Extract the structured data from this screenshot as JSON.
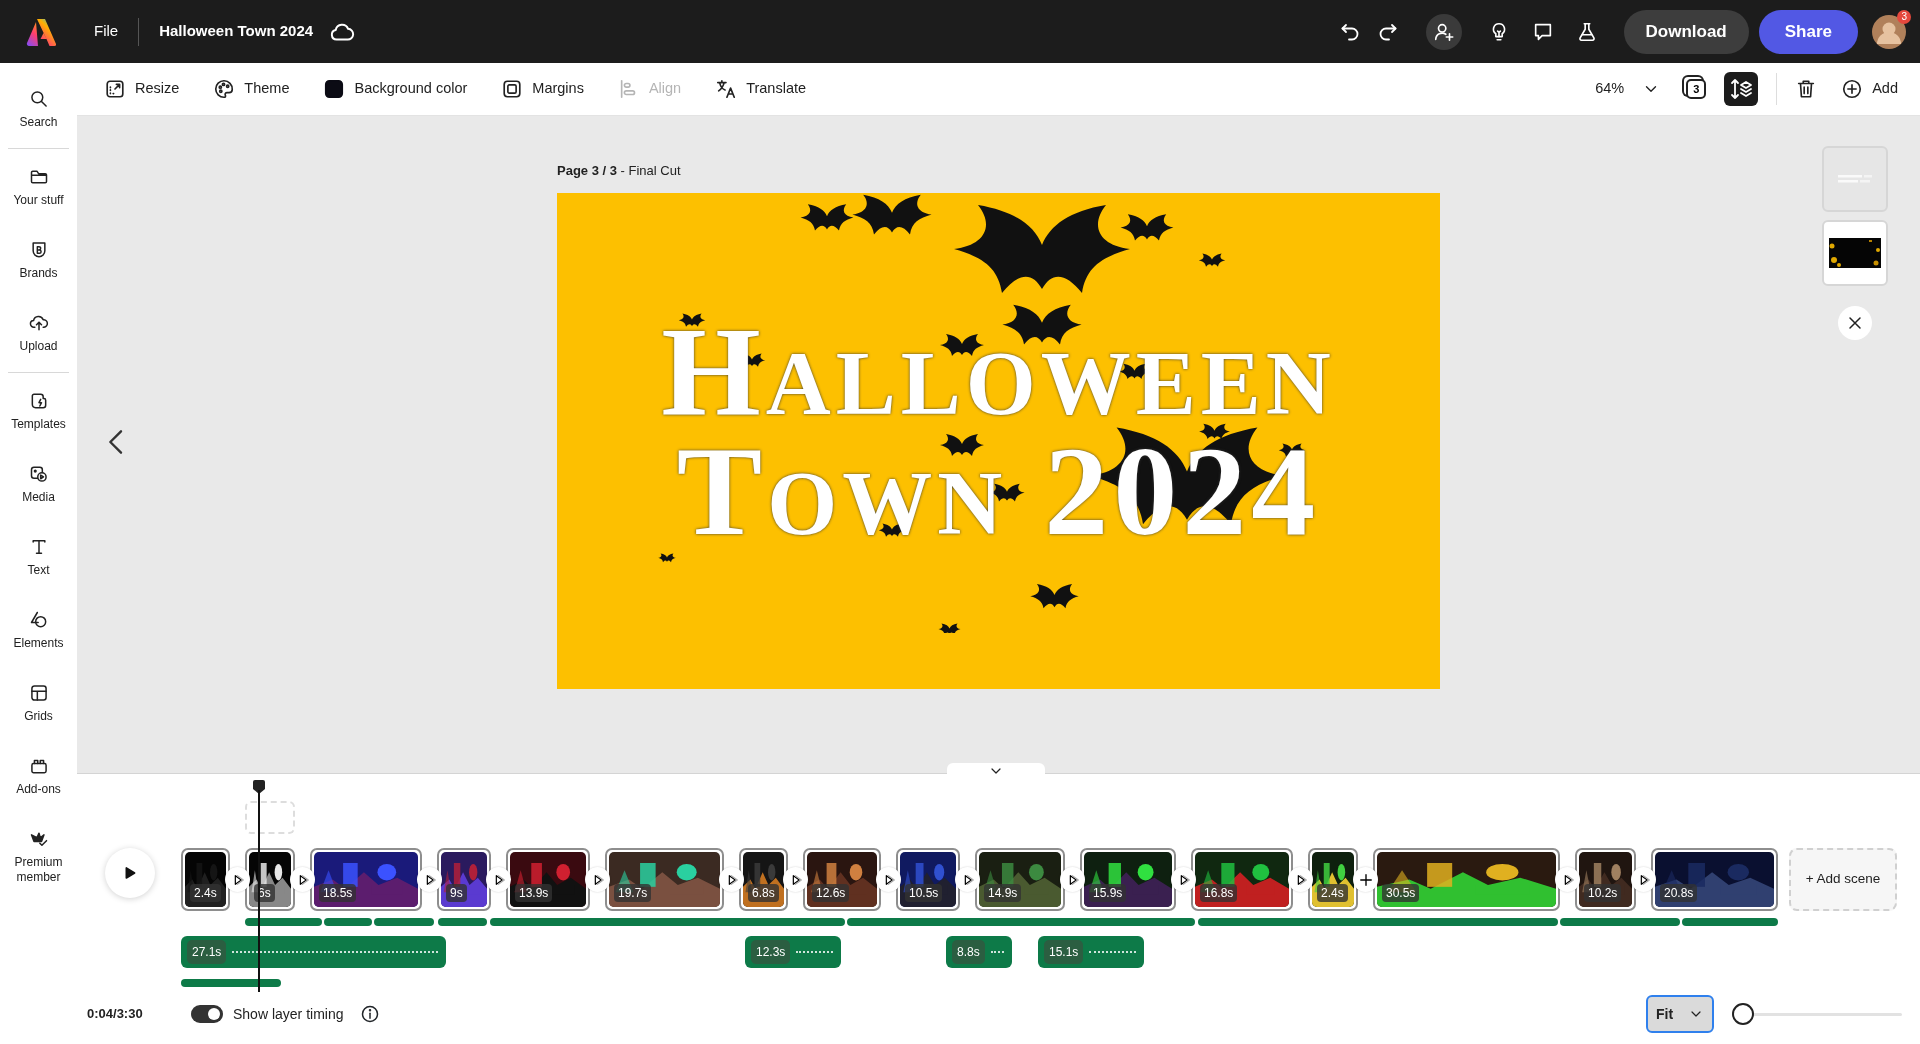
{
  "app_bar": {
    "menu": "File",
    "document_title": "Halloween Town 2024",
    "avatar_badge": "3",
    "buttons": [
      {
        "label": "Download",
        "kind": "secondary"
      },
      {
        "label": "Share",
        "kind": "primary"
      }
    ]
  },
  "sidebar": {
    "groups": [
      [
        {
          "label": "Search"
        }
      ],
      [
        {
          "label": "Your stuff"
        },
        {
          "label": "Brands"
        },
        {
          "label": "Upload"
        }
      ],
      [
        {
          "label": "Templates"
        },
        {
          "label": "Media"
        },
        {
          "label": "Text"
        },
        {
          "label": "Elements"
        },
        {
          "label": "Grids"
        },
        {
          "label": "Add-ons"
        },
        {
          "label": "Premium member"
        }
      ]
    ]
  },
  "toolbar": {
    "items": [
      {
        "label": "Resize",
        "disabled": false
      },
      {
        "label": "Theme",
        "disabled": false
      },
      {
        "label": "Background color",
        "disabled": false
      },
      {
        "label": "Margins",
        "disabled": false
      },
      {
        "label": "Align",
        "disabled": true
      },
      {
        "label": "Translate",
        "disabled": false
      }
    ],
    "zoom": "64%",
    "page_count": "3",
    "scene_view_on": true,
    "add": "Add"
  },
  "canvas": {
    "page_label": "**Page 3 / 3** - Final Cut",
    "title_lines": [
      "Halloween",
      "Town 2024"
    ]
  },
  "pages": [
    {
      "selected": false
    },
    {
      "selected": true
    }
  ],
  "timeline": {
    "time": "0:04/3:30",
    "layer_timing": {
      "label": "Show layer timing",
      "on": true
    },
    "scenes": [
      {
        "duration": "2.4s"
      },
      {
        "duration": "6s"
      },
      {
        "duration": "18.5s"
      },
      {
        "duration": "9s"
      },
      {
        "duration": "13.9s"
      },
      {
        "duration": "19.7s"
      },
      {
        "duration": "6.8s"
      },
      {
        "duration": "12.6s"
      },
      {
        "duration": "10.5s"
      },
      {
        "duration": "14.9s"
      },
      {
        "duration": "15.9s"
      },
      {
        "duration": "16.8s"
      },
      {
        "duration": "2.4s"
      },
      {
        "duration": "30.5s"
      },
      {
        "duration": "10.2s"
      },
      {
        "duration": "20.8s"
      }
    ],
    "joins": [
      {
        "kind": "transition"
      },
      {
        "kind": "transition"
      },
      {
        "kind": "transition"
      },
      {
        "kind": "transition"
      },
      {
        "kind": "transition"
      },
      {
        "kind": "transition"
      },
      {
        "kind": "transition"
      },
      {
        "kind": "transition"
      },
      {
        "kind": "transition"
      },
      {
        "kind": "transition"
      },
      {
        "kind": "transition"
      },
      {
        "kind": "transition"
      },
      {
        "kind": "add"
      },
      {
        "kind": "transition"
      },
      {
        "kind": "transition"
      }
    ],
    "add_scene": "+ Add scene",
    "layers": [
      {
        "kind": "labeled",
        "duration": "27.1s"
      },
      {
        "kind": "labeled",
        "duration": "12.3s"
      },
      {
        "kind": "labeled",
        "duration": "8.8s"
      },
      {
        "kind": "labeled",
        "duration": "15.1s"
      },
      {
        "kind": "plain"
      }
    ],
    "fit": "Fit",
    "zoom_slider": {
      "level": 0.0
    }
  }
}
